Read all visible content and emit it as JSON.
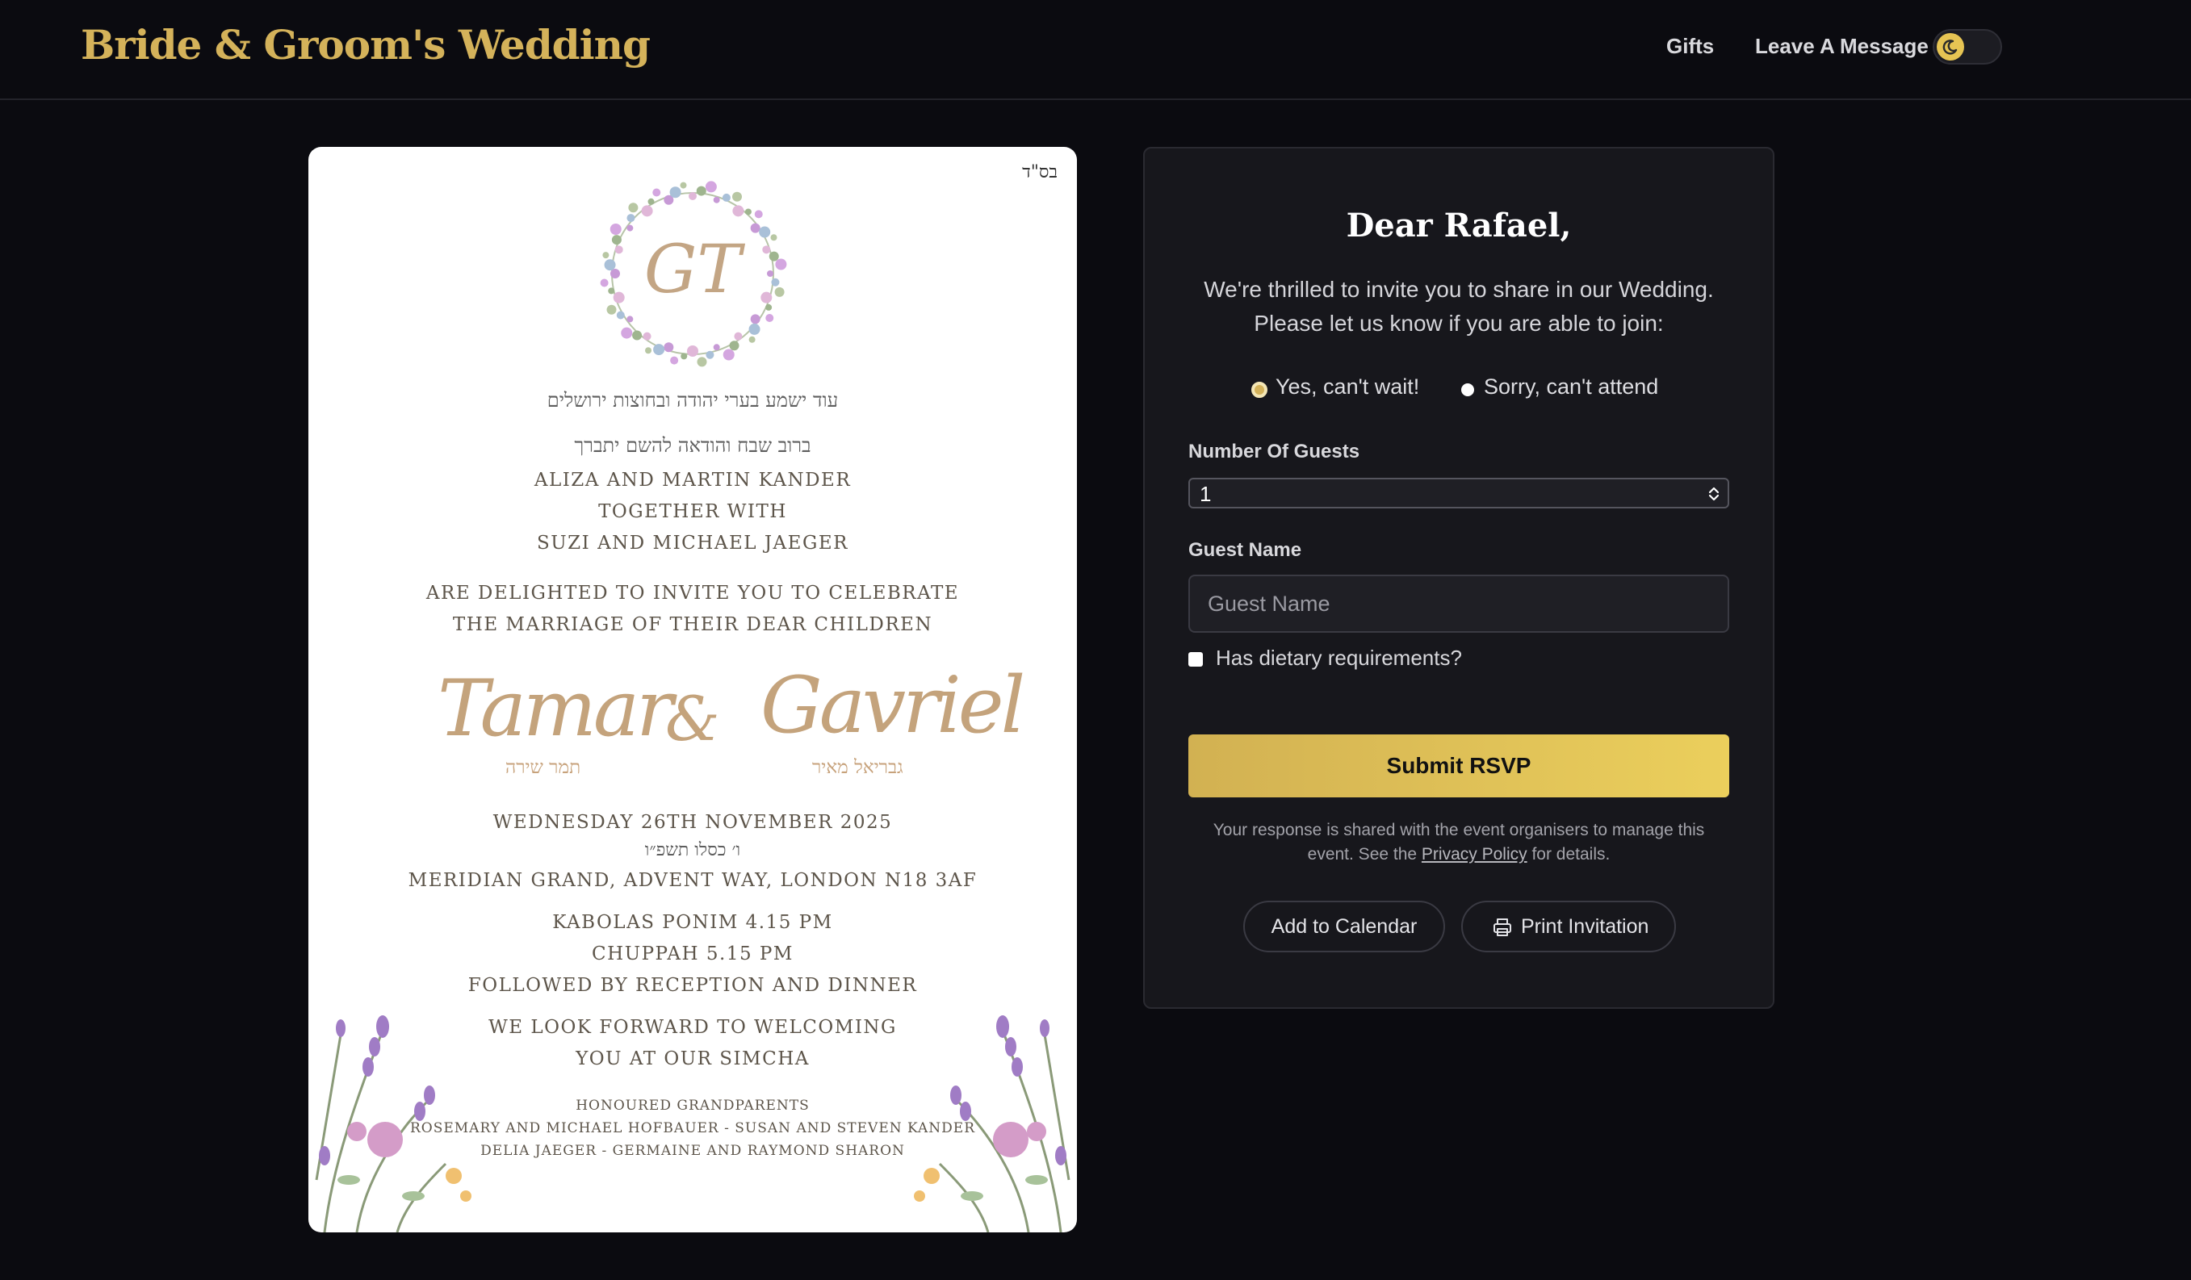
{
  "header": {
    "site_title": "Bride & Groom's Wedding",
    "nav": {
      "gifts": "Gifts",
      "leave_message": "Leave A Message"
    },
    "theme_toggle_icon": "moon-icon",
    "accent_color": "#d4b25a"
  },
  "invitation": {
    "bsd": "בס\"ד",
    "monogram": "GT",
    "hebrew_verse_1": "עוד ישמע בערי יהודה ובחוצות ירושלים",
    "hebrew_verse_2": "ברוב שבח והודאה להשם יתברך",
    "parents_1": "Aliza and Martin Kander",
    "together_with": "together with",
    "parents_2": "Suzi and Michael Jaeger",
    "invite_line_1": "are delighted to invite you to celebrate",
    "invite_line_2": "the marriage of their dear children",
    "bride_name": "Tamar",
    "ampersand": "&",
    "groom_name": "Gavriel",
    "bride_hebrew": "תמר שירה",
    "groom_hebrew": "גבריאל מאיר",
    "date": "Wednesday 26th November 2025",
    "hebrew_date": "ו׳ כסלו תשפ״ו",
    "venue": "Meridian Grand, Advent Way, London N18 3AF",
    "kabolas_ponim": "Kabolas Ponim 4.15 pm",
    "chuppah": "Chuppah 5.15 pm",
    "reception": "followed by reception and dinner",
    "welcome_1": "We look forward to welcoming",
    "welcome_2": "you at our simcha",
    "grandparents_title": "Honoured Grandparents",
    "grandparents_1": "Rosemary and Michael Hofbauer  -  Susan and Steven Kander",
    "grandparents_2": "Delia Jaeger  -  Germaine and Raymond Sharon"
  },
  "rsvp": {
    "greeting": "Dear Rafael,",
    "intro_1": "We're thrilled to invite you to share in our Wedding.",
    "intro_2": "Please let us know if you are able to join:",
    "option_yes": "Yes, can't wait!",
    "option_no": "Sorry, can't attend",
    "selected_option": "yes",
    "guests_label": "Number Of Guests",
    "guests_value": "1",
    "guest_name_label": "Guest Name",
    "guest_name_placeholder": "Guest Name",
    "dietary_label": "Has dietary requirements?",
    "submit_label": "Submit RSVP",
    "disclaimer_before": "Your response is shared with the event organisers to manage this event. See the ",
    "privacy_link": "Privacy Policy",
    "disclaimer_after": " for details.",
    "add_calendar": "Add to Calendar",
    "print_invitation": "Print Invitation",
    "print_icon": "printer-icon"
  }
}
